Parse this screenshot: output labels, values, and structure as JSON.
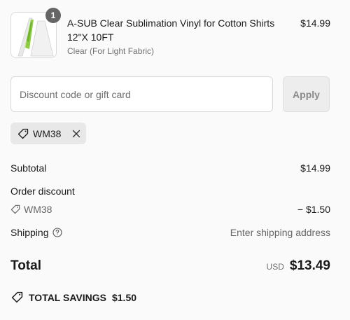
{
  "product": {
    "quantity": "1",
    "title": "A-SUB Clear Sublimation Vinyl for Cotton Shirts 12\"X 10FT",
    "variant": "Clear (For Light Fabric)",
    "price": "$14.99"
  },
  "discount": {
    "placeholder": "Discount code or gift card",
    "apply_label": "Apply",
    "applied_code": "WM38"
  },
  "summary": {
    "subtotal_label": "Subtotal",
    "subtotal_value": "$14.99",
    "order_discount_label": "Order discount",
    "discount_code": "WM38",
    "discount_value": "− $1.50",
    "shipping_label": "Shipping",
    "shipping_value": "Enter shipping address",
    "total_label": "Total",
    "currency": "USD",
    "total_value": "$13.49",
    "savings_label": "TOTAL SAVINGS",
    "savings_value": "$1.50"
  },
  "icons": {
    "tag": "tag-icon",
    "close": "close-icon",
    "help": "help-circle-icon"
  }
}
